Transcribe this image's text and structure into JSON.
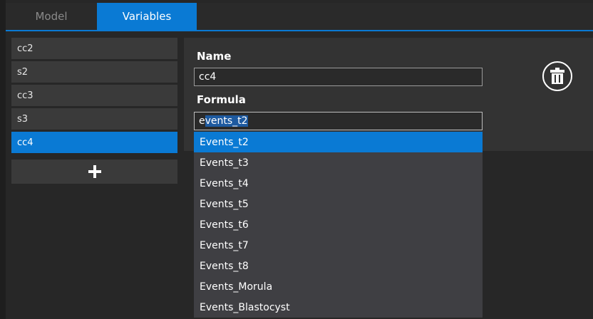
{
  "tabs": [
    {
      "label": "Model",
      "active": false
    },
    {
      "label": "Variables",
      "active": true
    }
  ],
  "sidebar": {
    "items": [
      {
        "label": "cc2"
      },
      {
        "label": "s2"
      },
      {
        "label": "cc3"
      },
      {
        "label": "s3"
      },
      {
        "label": "cc4",
        "selected": true
      }
    ],
    "add_icon": "plus-icon"
  },
  "detail": {
    "name_label": "Name",
    "name_value": "cc4",
    "formula_label": "Formula",
    "formula_typed": "e",
    "formula_autocomplete": "vents_t2",
    "delete_icon": "trash-icon"
  },
  "autocomplete": {
    "items": [
      "Events_t2",
      "Events_t3",
      "Events_t4",
      "Events_t5",
      "Events_t6",
      "Events_t7",
      "Events_t8",
      "Events_Morula",
      "Events_Blastocyst"
    ],
    "highlighted": "Events_t2"
  },
  "colors": {
    "accent": "#0a7ad4",
    "background": "#272727",
    "panel": "#333333",
    "list_item": "#3a3a3a",
    "dropdown": "#3f3f43"
  }
}
